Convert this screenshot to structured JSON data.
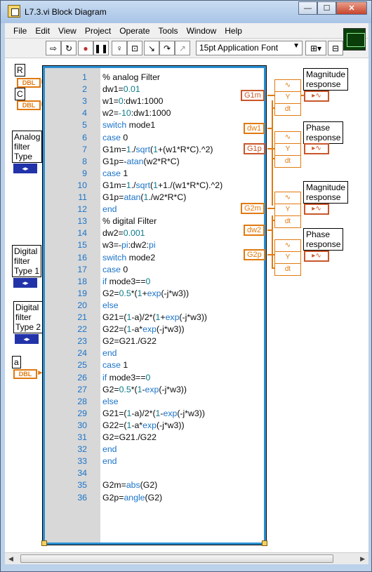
{
  "window": {
    "title": "L7.3.vi Block Diagram",
    "controls": {
      "minimize": "—",
      "maximize": "☐",
      "close": "✕"
    }
  },
  "menu": [
    "File",
    "Edit",
    "View",
    "Project",
    "Operate",
    "Tools",
    "Window",
    "Help"
  ],
  "toolbar": {
    "font": "15pt Application Font",
    "icons": [
      "run-arrow-icon",
      "run-continuous-icon",
      "abort-icon",
      "pause-icon",
      "highlight-execution-icon",
      "retain-wire-values-icon",
      "step-into-icon",
      "step-over-icon",
      "step-out-icon",
      "align-icon",
      "distribute-icon"
    ]
  },
  "controls": {
    "R": "R",
    "C": "C",
    "a": "a",
    "dbl": "DBL",
    "analog_type": "Analog\nfilter\nType",
    "digital_type1": "Digital\nfilter\nType 1",
    "digital_type2": "Digital\nfilter\nType 2",
    "mode1": "mode1",
    "mode2": "mode2",
    "mode3": "mode3"
  },
  "outputs": {
    "G1m": "G1m",
    "G1p": "G1p",
    "G2m": "G2m",
    "G2p": "G2p",
    "dw1": "dw1",
    "dw2": "dw2",
    "mag1": "Magnitude\nresponse",
    "phase1": "Phase\nresponse",
    "mag2": "Magnitude\nresponse",
    "phase2": "Phase\nresponse",
    "Y": "Y",
    "dt": "dt"
  },
  "code": [
    {
      "n": "1",
      "t": "% analog Filter"
    },
    {
      "n": "2",
      "t": "dw1=0.01"
    },
    {
      "n": "3",
      "t": "w1=0:dw1:1000"
    },
    {
      "n": "4",
      "t": "w2=-10:dw1:1000"
    },
    {
      "n": "5",
      "t": "switch mode1"
    },
    {
      "n": "6",
      "t": "case 0"
    },
    {
      "n": "7",
      "t": "G1m=1./sqrt(1+(w1*R*C).^2)"
    },
    {
      "n": "8",
      "t": "G1p=-atan(w2*R*C)"
    },
    {
      "n": "9",
      "t": "case 1"
    },
    {
      "n": "10",
      "t": "G1m=1./sqrt(1+1./(w1*R*C).^2)"
    },
    {
      "n": "11",
      "t": "G1p=atan(1./w2*R*C)"
    },
    {
      "n": "12",
      "t": "end"
    },
    {
      "n": "13",
      "t": "% digital Filter"
    },
    {
      "n": "14",
      "t": "dw2=0.001"
    },
    {
      "n": "15",
      "t": "w3=-pi:dw2:pi"
    },
    {
      "n": "16",
      "t": "switch mode2"
    },
    {
      "n": "17",
      "t": "case 0"
    },
    {
      "n": "18",
      "t": "if mode3==0"
    },
    {
      "n": "19",
      "t": "G2=0.5*(1+exp(-j*w3))"
    },
    {
      "n": "20",
      "t": "else"
    },
    {
      "n": "21",
      "t": "G21=(1-a)/2*(1+exp(-j*w3))"
    },
    {
      "n": "22",
      "t": "G22=(1-a*exp(-j*w3))"
    },
    {
      "n": "23",
      "t": "G2=G21./G22"
    },
    {
      "n": "24",
      "t": "end"
    },
    {
      "n": "25",
      "t": "case 1"
    },
    {
      "n": "26",
      "t": "if mode3==0"
    },
    {
      "n": "27",
      "t": "G2=0.5*(1-exp(-j*w3))"
    },
    {
      "n": "28",
      "t": "else"
    },
    {
      "n": "29",
      "t": "G21=(1-a)/2*(1-exp(-j*w3))"
    },
    {
      "n": "30",
      "t": "G22=(1-a*exp(-j*w3))"
    },
    {
      "n": "31",
      "t": "G2=G21./G22"
    },
    {
      "n": "32",
      "t": "end"
    },
    {
      "n": "33",
      "t": "end"
    },
    {
      "n": "34",
      "t": ""
    },
    {
      "n": "35",
      "t": "G2m=abs(G2)"
    },
    {
      "n": "36",
      "t": "G2p=angle(G2)"
    }
  ],
  "colors": {
    "frame": "#2a8fd2",
    "line_numbers": "#1a73c9",
    "comment": "#2a8f3a",
    "dbl_wire": "#e07a10",
    "enum_wire": "#2233aa"
  }
}
